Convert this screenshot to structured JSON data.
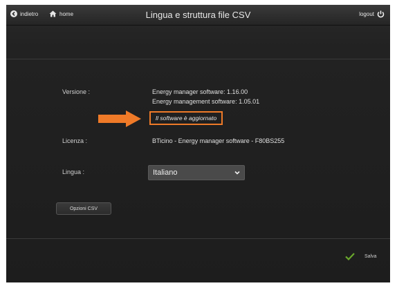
{
  "header": {
    "back_label": "indietro",
    "home_label": "home",
    "title": "Lingua e struttura file CSV",
    "logout_label": "logout"
  },
  "version": {
    "label": "Versione :",
    "line1": "Energy manager software: 1.16.00",
    "line2": "Energy management software: 1.05.01",
    "status": "Il software è aggiornato"
  },
  "license": {
    "label": "Licenza :",
    "value": "BTicino - Energy manager software - F80BS255"
  },
  "language": {
    "label": "Lingua :",
    "selected": "Italiano"
  },
  "csv_button_label": "Opzioni CSV",
  "save_label": "Salva",
  "colors": {
    "highlight": "#ef7a28",
    "save_check": "#6aa82c"
  },
  "icons": [
    "back-icon",
    "home-icon",
    "power-icon",
    "chevron-down-icon",
    "arrow-right-icon",
    "check-icon"
  ]
}
